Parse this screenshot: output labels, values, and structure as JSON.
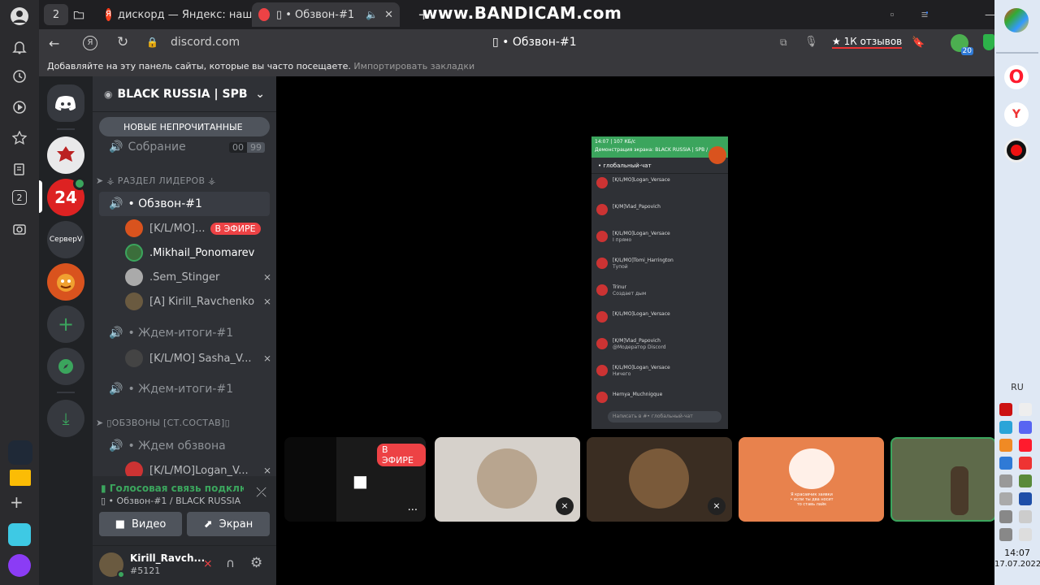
{
  "browser": {
    "tab_count": "2",
    "tabs": [
      {
        "label": "дискорд — Яндекс: нашло"
      },
      {
        "label": "▯ • Обзвон-#1"
      }
    ],
    "url": "discord.com",
    "page_title": "▯ • Обзвон-#1",
    "reviews": "1К отзывов",
    "ext_badge": "20",
    "bookmarks_hint": "Добавляйте на эту панель сайты, которые вы часто посещаете.",
    "bookmarks_import": "Импортировать закладки",
    "rail_badge": "2"
  },
  "watermark": "www.BANDICAM.com",
  "servers": [
    {
      "label": "24"
    },
    {
      "label": "СерверV"
    }
  ],
  "server_name": "BLACK RUSSIA | SPB",
  "new_unread": "НОВЫЕ НЕПРОЧИТАННЫЕ",
  "channels": {
    "sobranie": {
      "name": "Собрание",
      "count_a": "00",
      "count_b": "99"
    },
    "cat_leaders": "➤ ⚶ РАЗДЕЛ ЛИДЕРОВ ⚶",
    "obzvon": {
      "name": "• Обзвон-#1"
    },
    "obzvon_users": [
      {
        "name": "[K/L/MO]...",
        "live": "В ЭФИРЕ"
      },
      {
        "name": ".Mikhail_Ponomarev"
      },
      {
        "name": ".Sem_Stinger"
      },
      {
        "name": "[A] Kirill_Ravchenko"
      }
    ],
    "zhdem1": {
      "name": "• Ждем-итоги-#1"
    },
    "zhdem1_users": [
      {
        "name": "[K/L/MO] Sasha_V..."
      }
    ],
    "zhdem2": {
      "name": "• Ждем-итоги-#1"
    },
    "cat_obzvony": "➤ ▯ОБЗВОНЫ [СТ.СОСТАВ]▯",
    "zhdem_obzvona": {
      "name": "• Ждем обзвона"
    },
    "zhdem_obzvona_users": [
      {
        "name": "[K/L/MO]Logan_V..."
      }
    ]
  },
  "voice": {
    "status": "Голосовая связь подключе",
    "channel": "▯ • Обзвон-#1 / BLACK RUSSIA ...",
    "video_label": "Видео",
    "screen_label": "Экран"
  },
  "user_panel": {
    "name": "Kirill_Ravch...",
    "tag": "#5121"
  },
  "stage": {
    "live_label": "В ЭФИРЕ",
    "more_label": "...",
    "phone_chat": {
      "status_left": "14:07 | 107 КБ/с",
      "header": "Демонстрация экрана: BLACK RUSSIA | SPB /",
      "channel": "• глобальный-чат",
      "messages": [
        {
          "author": "[K/L/MO]Logan_Versace",
          "text": ""
        },
        {
          "author": "[K/M]Vlad_Papovich",
          "text": ""
        },
        {
          "author": "[K/L/MO]Logan_Versace",
          "text": "I прямо"
        },
        {
          "author": "[K/L/MO]Tomi_Harrington",
          "text": "Тупой"
        },
        {
          "author": "Trinur",
          "text": "Создает дым"
        },
        {
          "author": "[K/L/MO]Logan_Versace",
          "text": ""
        },
        {
          "author": "[K/M]Vlad_Papovich",
          "text": "@Модератор Discord"
        },
        {
          "author": "[K/L/MO]Logan_Versace",
          "text": "Ничего"
        },
        {
          "author": "Hernya_Muchnigque",
          "text": ""
        }
      ],
      "input_placeholder": "Написать в #• глобальный-чат"
    },
    "tile_caption": "Я красавчик заявки\n• если ты два носит\nто ставь лайк"
  },
  "taskbar": {
    "lang": "RU",
    "time": "14:07",
    "date": "17.07.2022"
  }
}
